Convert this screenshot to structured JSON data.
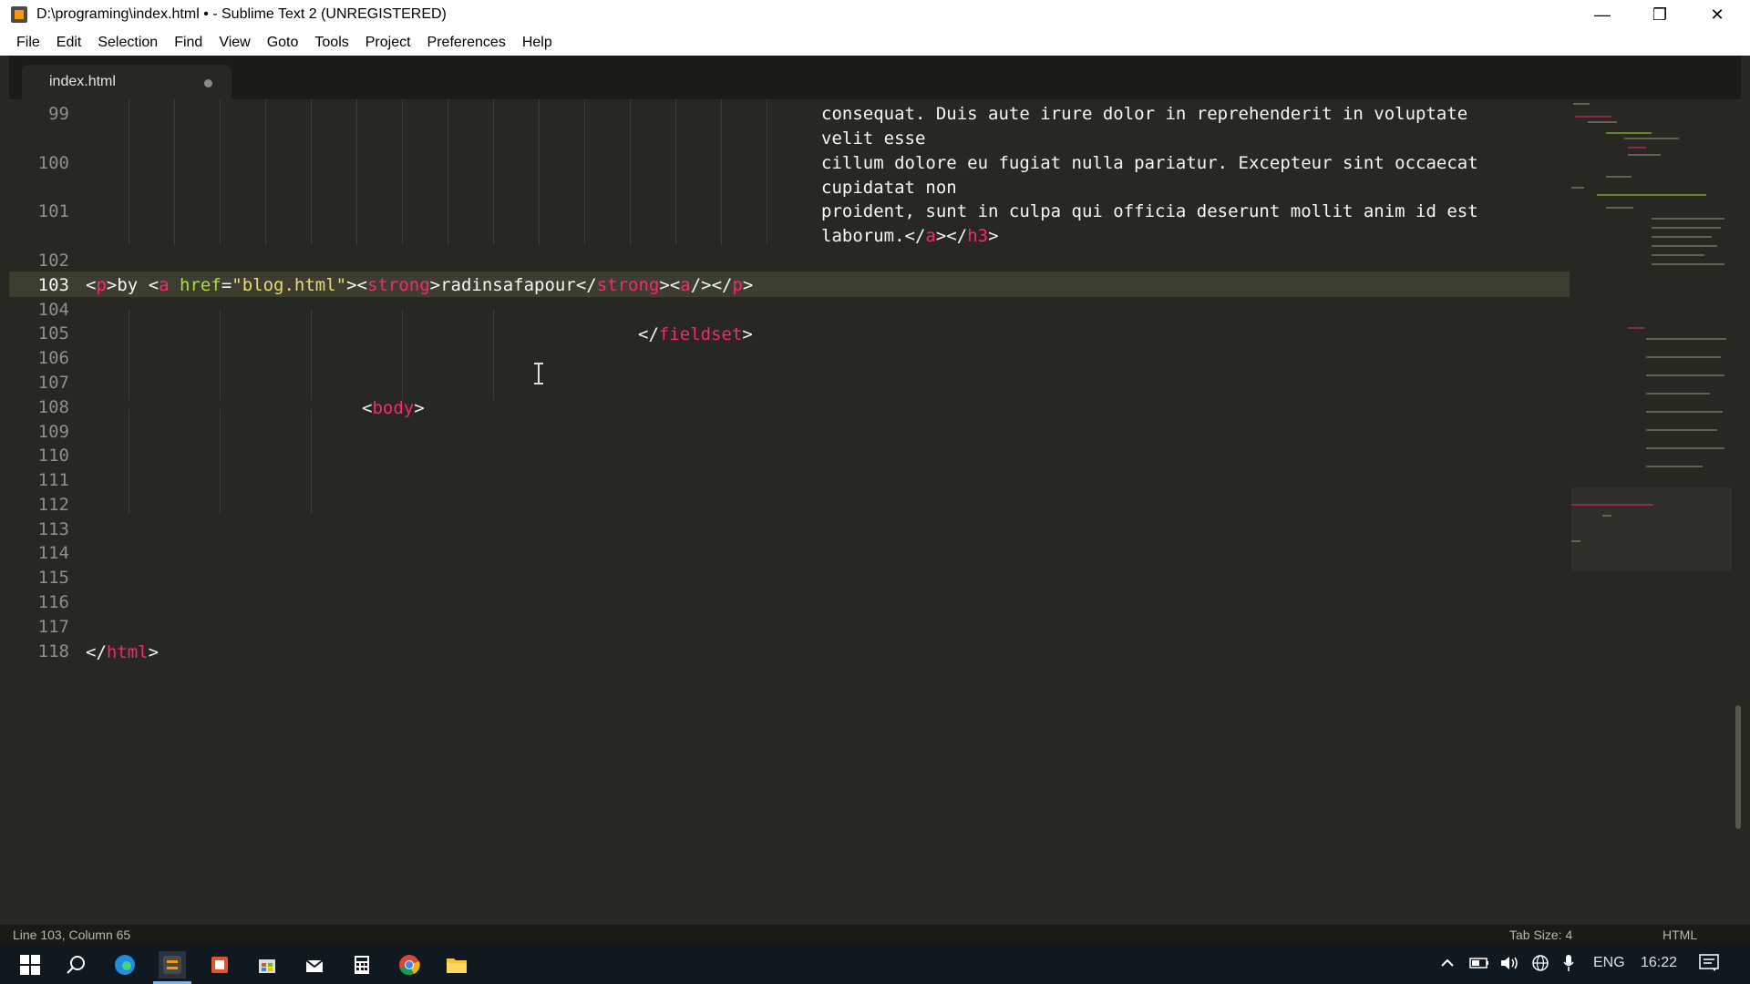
{
  "window": {
    "title": "D:\\programing\\index.html • - Sublime Text 2 (UNREGISTERED)",
    "controls": {
      "minimize": "—",
      "maximize": "❐",
      "close": "✕"
    }
  },
  "menu": [
    "File",
    "Edit",
    "Selection",
    "Find",
    "View",
    "Goto",
    "Tools",
    "Project",
    "Preferences",
    "Help"
  ],
  "tab": {
    "label": "index.html",
    "modified": true
  },
  "editor": {
    "line_numbers": [
      "99",
      "100",
      "101",
      "102",
      "103",
      "104",
      "105",
      "106",
      "107",
      "108",
      "109",
      "110",
      "111",
      "112",
      "113",
      "114",
      "115",
      "116",
      "117",
      "118"
    ],
    "active_line": "103",
    "text_99a": "consequat. Duis aute irure dolor in reprehenderit in voluptate",
    "text_99b": "velit esse",
    "text_100a": "cillum dolore eu fugiat nulla pariatur. Excepteur sint occaecat",
    "text_100b": "cupidatat non",
    "text_101a": "proident, sunt in culpa qui officia deserunt mollit anim id est",
    "text_101b": "laborum.",
    "line103": {
      "p_open": "p",
      "by": "by ",
      "a": "a",
      "href_attr": "href",
      "href_val": "\"blog.html\"",
      "strong": "strong",
      "name": "radinsafapour",
      "strong_close": "strong",
      "a_close": "a",
      "p_close": "p"
    },
    "tag_a": "a",
    "tag_h3": "h3",
    "tag_fieldset": "fieldset",
    "tag_body": "body",
    "tag_html": "html"
  },
  "status": {
    "position": "Line 103, Column 65",
    "tab_size": "Tab Size: 4",
    "syntax": "HTML"
  },
  "taskbar": {
    "icons": [
      "windows-start-icon",
      "search-icon",
      "edge-browser-icon",
      "sublime-text-icon",
      "office-icon",
      "store-icon",
      "mail-icon",
      "calculator-icon",
      "chrome-icon",
      "file-explorer-icon"
    ],
    "language": "ENG",
    "time": "16:22"
  },
  "colors": {
    "background": "#272822",
    "tag": "#f92672",
    "attribute": "#a6e22e",
    "string": "#e6db74",
    "text": "#f8f8f2"
  }
}
